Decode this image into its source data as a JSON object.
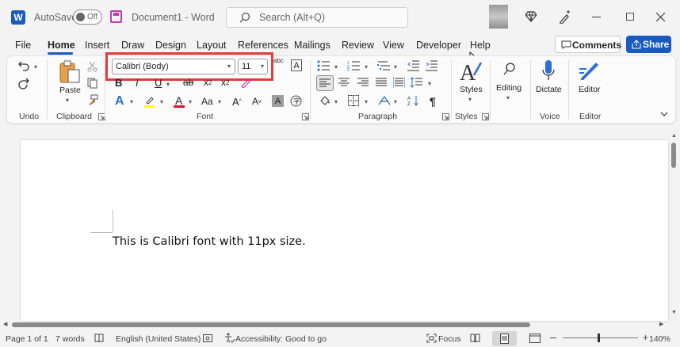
{
  "titlebar": {
    "autosave_label": "AutoSave",
    "autosave_state": "Off",
    "document_title": "Document1",
    "separator": "-",
    "app_name": "Word",
    "search_placeholder": "Search (Alt+Q)"
  },
  "tabs": [
    "File",
    "Home",
    "Insert",
    "Draw",
    "Design",
    "Layout",
    "References",
    "Mailings",
    "Review",
    "View",
    "Developer",
    "Help"
  ],
  "active_tab": "Home",
  "comments_label": "Comments",
  "share_label": "Share",
  "ribbon": {
    "undo_group": "Undo",
    "clipboard_group": "Clipboard",
    "paste_label": "Paste",
    "font_group": "Font",
    "font_name": "Calibri (Body)",
    "font_size": "11",
    "paragraph_group": "Paragraph",
    "styles_label": "Styles",
    "styles_group": "Styles",
    "editing_label": "Editing",
    "dictate_label": "Dictate",
    "voice_group": "Voice",
    "editor_label": "Editor",
    "editor_group": "Editor"
  },
  "document": {
    "body_text": "This is Calibri font with 11px size."
  },
  "statusbar": {
    "page": "Page 1 of 1",
    "words": "7 words",
    "language": "English (United States)",
    "accessibility": "Accessibility: Good to go",
    "focus": "Focus",
    "zoom": "140%"
  },
  "colors": {
    "accent": "#185abd",
    "highlight_box": "#e03c3c",
    "font_color_underline": "#e81123",
    "highlight_color": "#ffff00"
  }
}
